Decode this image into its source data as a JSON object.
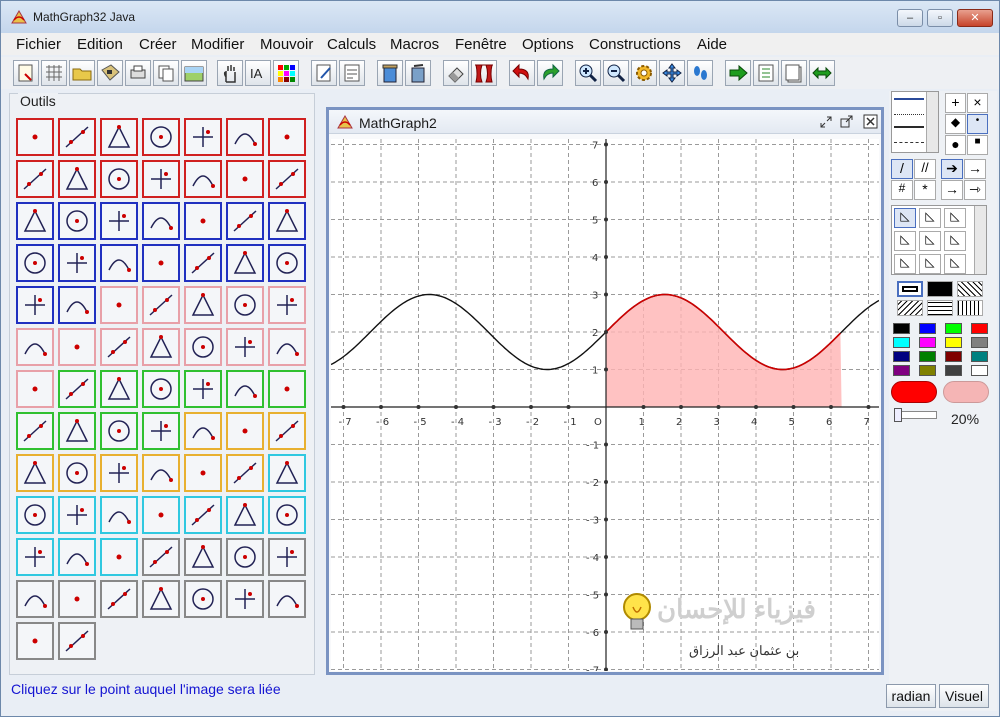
{
  "window": {
    "title": "MathGraph32 Java"
  },
  "menu": [
    "Fichier",
    "Edition",
    "Créer",
    "Modifier",
    "Mouvoir",
    "Calculs",
    "Macros",
    "Fenêtre",
    "Options",
    "Constructions",
    "Aide"
  ],
  "tools_panel": {
    "label": "Outils"
  },
  "status": "Cliquez sur le point auquel l'image sera liée",
  "document": {
    "title": "MathGraph2"
  },
  "graph": {
    "x_ticks": [
      "- 7",
      "- 6",
      "- 5",
      "- 4",
      "- 3",
      "- 2",
      "- 1",
      "O",
      "1",
      "2",
      "3",
      "4",
      "5",
      "6",
      "7"
    ],
    "y_ticks_pos": [
      "1",
      "2",
      "3",
      "4",
      "5",
      "6",
      "7"
    ],
    "y_ticks_neg": [
      "- 1",
      "- 2",
      "- 3",
      "- 4",
      "- 5",
      "- 6",
      "- 7"
    ],
    "curve_color": "#111111",
    "highlight_color": "#cc0000",
    "fill_color": "#ffb3b3"
  },
  "right_panel": {
    "opacity_label": "20%"
  },
  "buttons": {
    "radian": "radian",
    "visuel": "Visuel"
  },
  "watermark": {
    "main": "فيزياء للإحسان",
    "sub": "بن عثمان عبد الرزاق"
  }
}
